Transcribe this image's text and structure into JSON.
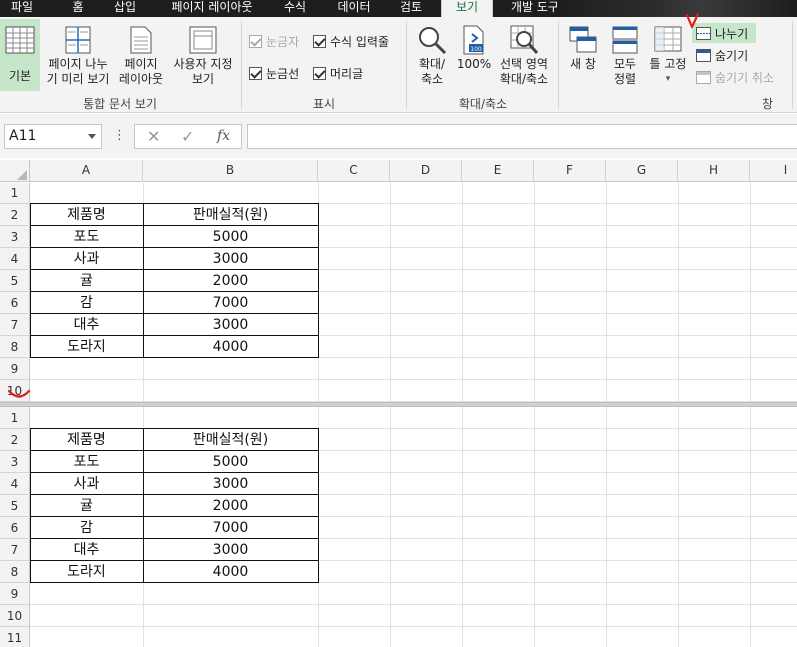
{
  "tabs": [
    "파일",
    "홈",
    "삽입",
    "페이지 레이아웃",
    "수식",
    "데이터",
    "검토",
    "보기",
    "개발 도구"
  ],
  "active_tab": "보기",
  "ribbon": {
    "workbook_views": {
      "label": "통합 문서 보기",
      "normal": "기본",
      "page_break_l1": "페이지 나누",
      "page_break_l2": "기 미리 보기",
      "page_layout_l1": "페이지",
      "page_layout_l2": "레이아웃",
      "custom_l1": "사용자 지정",
      "custom_l2": "보기"
    },
    "show": {
      "label": "표시",
      "ruler": "눈금자",
      "formula_bar": "수식 입력줄",
      "gridlines": "눈금선",
      "headings": "머리글"
    },
    "zoom": {
      "label": "확대/축소",
      "zoom_l1": "확대/",
      "zoom_l2": "축소",
      "hundred": "100%",
      "zoom_sel_l1": "선택 영역",
      "zoom_sel_l2": "확대/축소"
    },
    "window": {
      "label": "창",
      "new_window": "새 창",
      "arrange_l1": "모두",
      "arrange_l2": "정렬",
      "freeze": "틀 고정",
      "split": "나누기",
      "hide": "숨기기",
      "unhide": "숨기기 취소"
    }
  },
  "formula_bar": {
    "name_box": "A11",
    "cancel": "✕",
    "enter": "✓",
    "fx": "fx",
    "content": ""
  },
  "columns": [
    "A",
    "B",
    "C",
    "D",
    "E",
    "F",
    "G",
    "H",
    "I"
  ],
  "top_pane_rows": [
    "1",
    "2",
    "3",
    "4",
    "5",
    "6",
    "7",
    "8",
    "9",
    "10"
  ],
  "bottom_pane_rows": [
    "1",
    "2",
    "3",
    "4",
    "5",
    "6",
    "7",
    "8",
    "9",
    "10",
    "11"
  ],
  "table": {
    "headers": [
      "제품명",
      "판매실적(원)"
    ],
    "rows": [
      [
        "포도",
        "5000"
      ],
      [
        "사과",
        "3000"
      ],
      [
        "귤",
        "2000"
      ],
      [
        "감",
        "7000"
      ],
      [
        "대추",
        "3000"
      ],
      [
        "도라지",
        "4000"
      ]
    ]
  },
  "colors": {
    "accent": "#217346",
    "selected_bg": "#c5e6c9",
    "annotation": "#e0201b"
  }
}
